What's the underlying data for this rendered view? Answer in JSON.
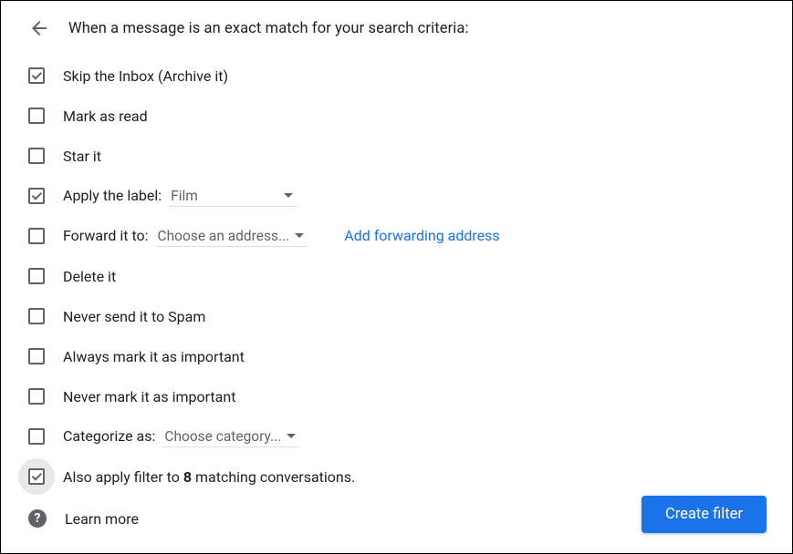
{
  "header": {
    "title": "When a message is an exact match for your search criteria:"
  },
  "options": {
    "skip_inbox": {
      "label": "Skip the Inbox (Archive it)",
      "checked": true
    },
    "mark_read": {
      "label": "Mark as read",
      "checked": false
    },
    "star_it": {
      "label": "Star it",
      "checked": false
    },
    "apply_label": {
      "label": "Apply the label:",
      "checked": true,
      "value": "Film"
    },
    "forward": {
      "label": "Forward it to:",
      "checked": false,
      "value": "Choose an address...",
      "link": "Add forwarding address"
    },
    "delete_it": {
      "label": "Delete it",
      "checked": false
    },
    "never_spam": {
      "label": "Never send it to Spam",
      "checked": false
    },
    "always_important": {
      "label": "Always mark it as important",
      "checked": false
    },
    "never_important": {
      "label": "Never mark it as important",
      "checked": false
    },
    "categorize": {
      "label": "Categorize as:",
      "checked": false,
      "value": "Choose category..."
    },
    "also_apply": {
      "prefix": "Also apply filter to ",
      "count": "8",
      "suffix": " matching conversations.",
      "checked": true
    }
  },
  "footer": {
    "learn_more": "Learn more",
    "create_button": "Create filter"
  }
}
